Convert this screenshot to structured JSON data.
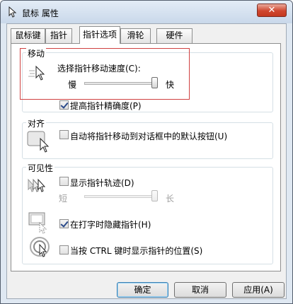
{
  "window": {
    "title": "鼠标 属性",
    "close_label": "✕"
  },
  "tabs": [
    {
      "label": "鼠标键",
      "active": false
    },
    {
      "label": "指针",
      "active": false
    },
    {
      "label": "指针选项",
      "active": true
    },
    {
      "label": "滑轮",
      "active": false
    },
    {
      "label": "硬件",
      "active": false
    }
  ],
  "motion": {
    "group_label": "移动",
    "speed_label": "选择指针移动速度(C):",
    "slow_label": "慢",
    "fast_label": "快",
    "speed_value": 1.0,
    "precision_label": "提高指针精确度(P)",
    "precision_checked": true
  },
  "snap": {
    "group_label": "对齐",
    "checkbox_label": "自动将指针移动到对话框中的默认按钮(U)",
    "checked": false
  },
  "visibility": {
    "group_label": "可见性",
    "trails_label": "显示指针轨迹(D)",
    "trails_checked": false,
    "short_label": "短",
    "long_label": "长",
    "trails_value": 1.0,
    "hide_label": "在打字时隐藏指针(H)",
    "hide_checked": true,
    "ctrl_label": "当按 CTRL 键时显示指针的位置(S)",
    "ctrl_checked": false
  },
  "buttons": {
    "ok": "确定",
    "cancel": "取消",
    "apply": "应用(A)"
  },
  "colors": {
    "highlight": "#d04040",
    "accent": "#3c7fb1"
  }
}
